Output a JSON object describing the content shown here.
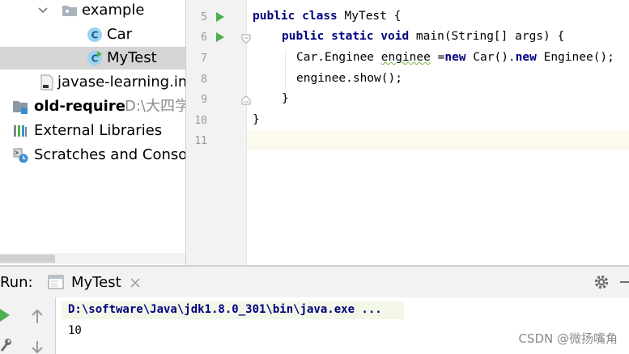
{
  "project_tree": {
    "items": [
      {
        "label": "example",
        "kind": "package"
      },
      {
        "label": "Car",
        "kind": "class"
      },
      {
        "label": "MyTest",
        "kind": "class-runnable",
        "selected": true
      },
      {
        "label": "javase-learning.iml",
        "kind": "iml-file"
      },
      {
        "label": "old-require",
        "path": "D:\\大四学",
        "kind": "module"
      },
      {
        "label": "External Libraries",
        "kind": "libraries"
      },
      {
        "label": "Scratches and Consoles",
        "kind": "scratches"
      }
    ]
  },
  "editor": {
    "line_numbers": [
      "5",
      "6",
      "7",
      "8",
      "9",
      "10",
      "11"
    ],
    "code": {
      "l5": {
        "kw1": "public",
        "kw2": "class",
        "rest": " MyTest {"
      },
      "l6": {
        "kw1": "public",
        "kw2": "static",
        "kw3": "void",
        "rest": " main(String[] args) {"
      },
      "l7": {
        "a": "Car.Enginee ",
        "var": "enginee",
        "b": " =",
        "kw1": "new",
        "c": " Car().",
        "kw2": "new",
        "d": " Enginee();"
      },
      "l8": "enginee.show();",
      "l9": "}",
      "l10": "}"
    },
    "current_line": "11"
  },
  "run_panel": {
    "label": "Run:",
    "tab_label": "MyTest",
    "command": "D:\\software\\Java\\jdk1.8.0_301\\bin\\java.exe ...",
    "output": "10"
  },
  "watermark": "CSDN @微扬嘴角",
  "colors": {
    "keyword": "#000080",
    "selected_row": "#d5d5d5",
    "caret_row": "#fcfaed",
    "run_green": "#4caf50",
    "class_icon": "#3d8fd1"
  }
}
